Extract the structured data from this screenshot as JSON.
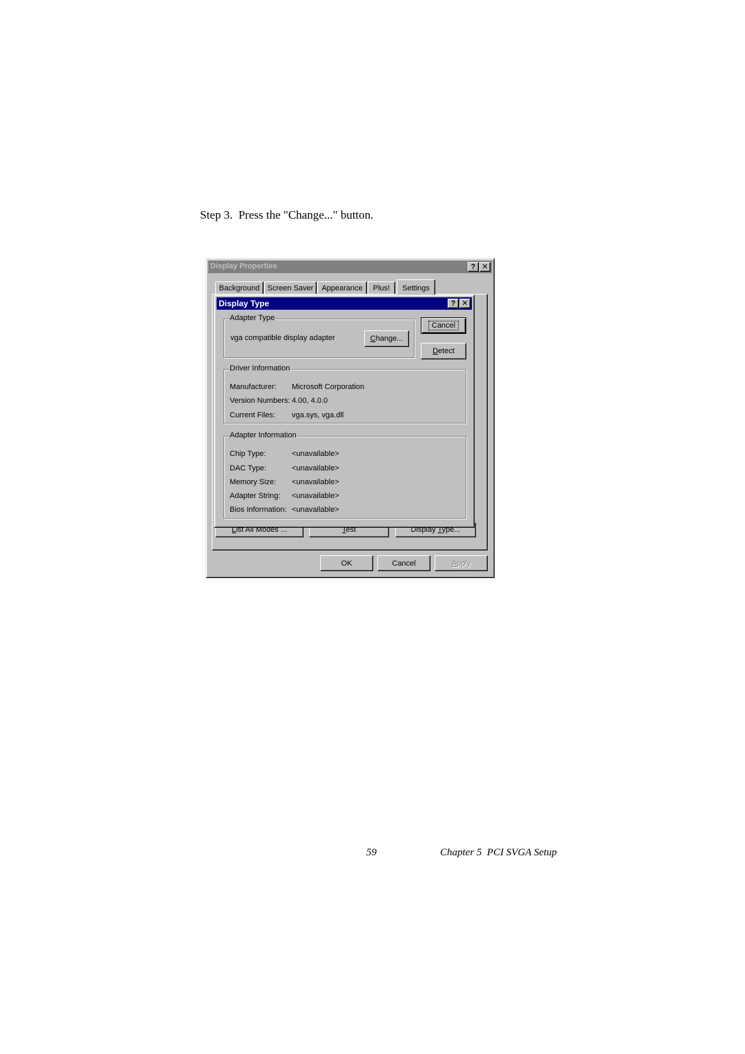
{
  "document": {
    "step_text": "Step 3.  Press the \"Change...\" button.",
    "page_number": "59",
    "chapter": "Chapter 5  PCI SVGA Setup"
  },
  "display_properties": {
    "title": "Display Properties",
    "help_button": "?",
    "close_button": "✕",
    "tabs": [
      {
        "label": "Background",
        "active": false
      },
      {
        "label": "Screen Saver",
        "active": false
      },
      {
        "label": "Appearance",
        "active": false
      },
      {
        "label": "Plus!",
        "active": false
      },
      {
        "label": "Settings",
        "active": true
      }
    ],
    "settings_buttons": {
      "list_all_modes": {
        "pre": "",
        "key": "L",
        "post": "ist All Modes ..."
      },
      "test": {
        "pre": "",
        "key": "T",
        "post": "est"
      },
      "display_type": {
        "pre": "Display ",
        "key": "T",
        "post": "ype..."
      }
    },
    "footer": {
      "ok": "OK",
      "cancel": "Cancel",
      "apply": {
        "key": "A",
        "post": "pply"
      }
    }
  },
  "display_type": {
    "title": "Display Type",
    "help_button": "?",
    "close_button": "✕",
    "adapter_type": {
      "label": "Adapter Type",
      "value": "vga compatible display adapter",
      "change_button": {
        "key": "C",
        "post": "hange..."
      }
    },
    "cancel_button": "Cancel",
    "detect_button": {
      "key": "D",
      "post": "etect"
    },
    "driver_information": {
      "label": "Driver Information",
      "rows": [
        {
          "key": "Manufacturer:",
          "value": "Microsoft Corporation"
        },
        {
          "key": "Version Numbers:",
          "value": "4.00, 4.0.0"
        },
        {
          "key": "Current Files:",
          "value": "vga.sys, vga.dll"
        }
      ]
    },
    "adapter_information": {
      "label": "Adapter Information",
      "rows": [
        {
          "key": "Chip Type:",
          "value": "<unavailable>"
        },
        {
          "key": "DAC Type:",
          "value": "<unavailable>"
        },
        {
          "key": "Memory Size:",
          "value": "<unavailable>"
        },
        {
          "key": "Adapter String:",
          "value": "<unavailable>"
        },
        {
          "key": "Bios Information:",
          "value": "<unavailable>"
        }
      ]
    }
  }
}
